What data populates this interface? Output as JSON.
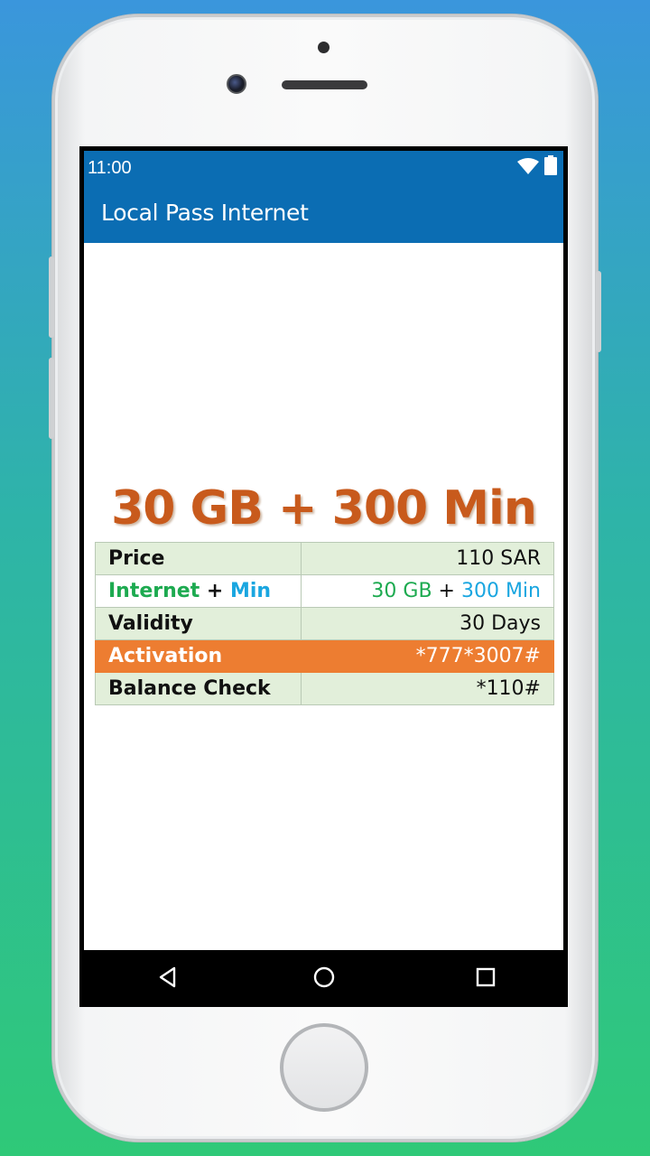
{
  "status_bar": {
    "time": "11:00",
    "icons": [
      "wifi-icon",
      "battery-icon"
    ]
  },
  "app_bar": {
    "title": "Local Pass Internet",
    "color": "#0b6db3"
  },
  "plan": {
    "headline": "30 GB + 300 Min",
    "headline_color": "#c85a1c",
    "rows": [
      {
        "label": "Price",
        "value": "110 SAR"
      },
      {
        "label_a": "Internet",
        "label_sep": " + ",
        "label_b": "Min",
        "value_a": "30 GB",
        "value_sep": " + ",
        "value_b": "300 Min"
      },
      {
        "label": "Validity",
        "value": "30 Days"
      },
      {
        "label": "Activation",
        "value": "*777*3007#"
      },
      {
        "label": "Balance Check",
        "value": "*110#"
      }
    ],
    "colors": {
      "shade": "#e2efda",
      "accent": "#ed7d31",
      "price": "#e02020",
      "internet": "#1daa50",
      "minutes": "#1aa6e0"
    }
  },
  "nav_bar": {
    "buttons": [
      "back-icon",
      "home-icon",
      "recents-icon"
    ]
  }
}
